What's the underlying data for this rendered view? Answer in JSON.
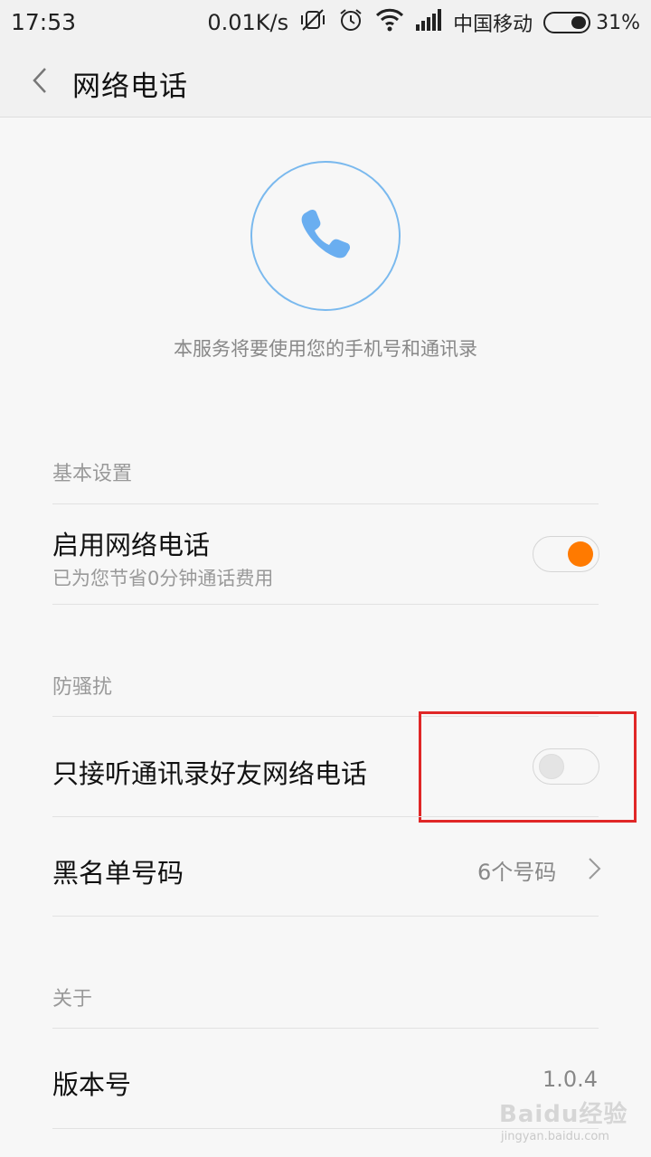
{
  "status_bar": {
    "time": "17:53",
    "net_speed": "0.01K/s",
    "carrier": "中国移动",
    "battery_percent": "31%",
    "icons": [
      "mute-vibrate-icon",
      "alarm-icon",
      "wifi-icon",
      "signal-icon",
      "battery-icon"
    ]
  },
  "header": {
    "title": "网络电话",
    "back_icon": "chevron-left-icon"
  },
  "hero": {
    "icon": "phone-icon",
    "description": "本服务将要使用您的手机号和通讯录"
  },
  "sections": {
    "basic": {
      "header": "基本设置",
      "enable": {
        "title": "启用网络电话",
        "subtitle": "已为您节省0分钟通话费用",
        "enabled": true
      }
    },
    "anti_harass": {
      "header": "防骚扰",
      "contacts_only": {
        "title": "只接听通讯录好友网络电话",
        "enabled": false
      },
      "blacklist": {
        "title": "黑名单号码",
        "value": "6个号码"
      }
    },
    "about": {
      "header": "关于",
      "version": {
        "title": "版本号",
        "value": "1.0.4"
      }
    }
  },
  "colors": {
    "accent_orange": "#ff7a00",
    "circle_blue": "#7ab9ee",
    "phone_blue": "#6aaef0",
    "highlight_red": "#e02727"
  },
  "watermark": {
    "main": "Baidu经验",
    "sub": "jingyan.baidu.com"
  }
}
